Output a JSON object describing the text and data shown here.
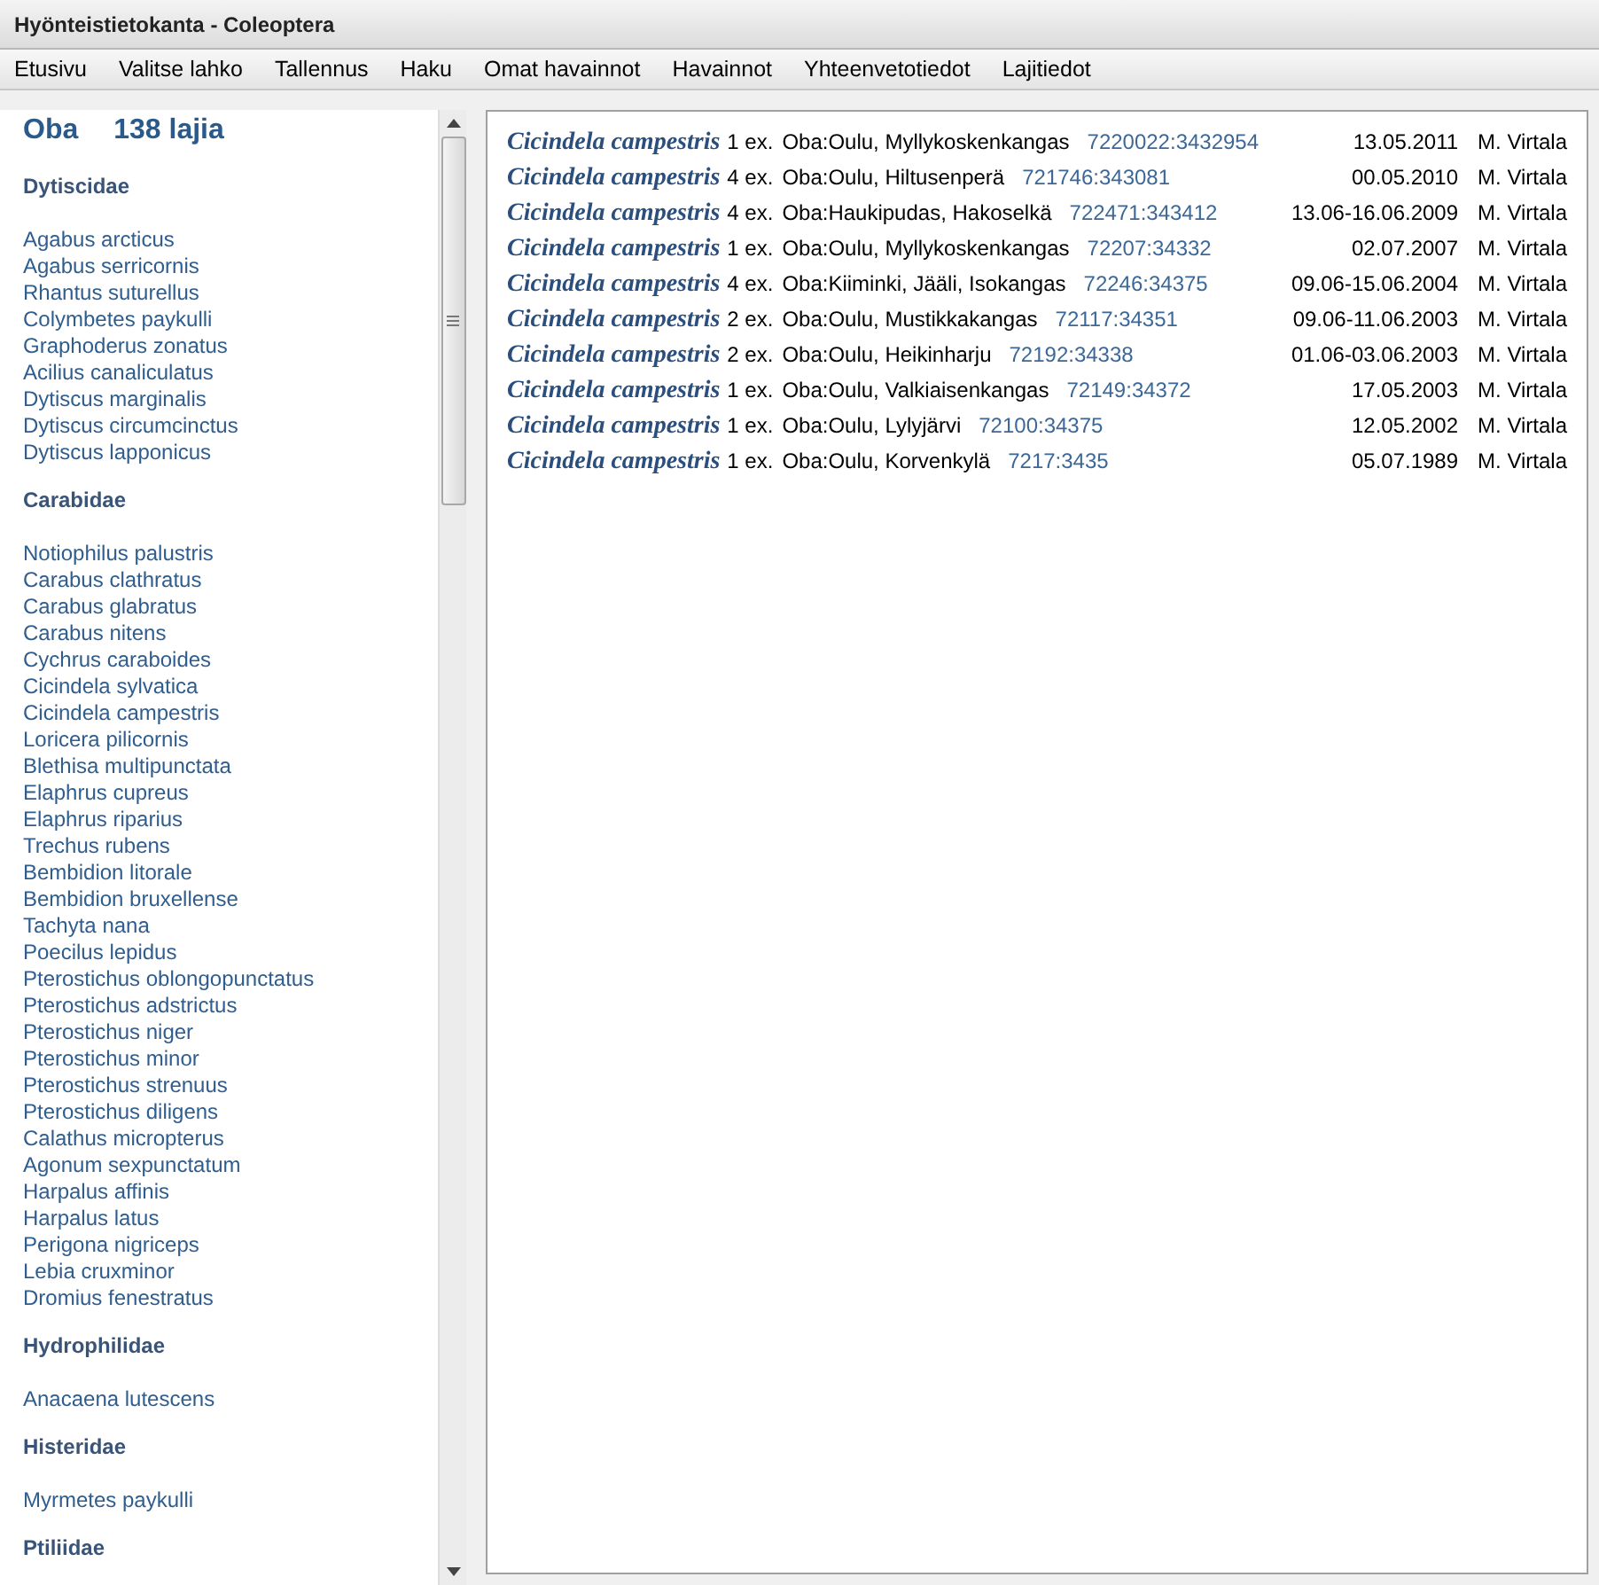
{
  "window": {
    "title": "Hyönteistietokanta - Coleoptera"
  },
  "menu": [
    "Etusivu",
    "Valitse lahko",
    "Tallennus",
    "Haku",
    "Omat havainnot",
    "Havainnot",
    "Yhteenvetotiedot",
    "Lajitiedot"
  ],
  "sidebar": {
    "region": "Oba",
    "count": "138 lajia",
    "families": [
      {
        "name": "Dytiscidae",
        "species": [
          "Agabus arcticus",
          "Agabus serricornis",
          "Rhantus suturellus",
          "Colymbetes paykulli",
          "Graphoderus zonatus",
          "Acilius canaliculatus",
          "Dytiscus marginalis",
          "Dytiscus circumcinctus",
          "Dytiscus lapponicus"
        ]
      },
      {
        "name": "Carabidae",
        "species": [
          "Notiophilus palustris",
          "Carabus clathratus",
          "Carabus glabratus",
          "Carabus nitens",
          "Cychrus caraboides",
          "Cicindela sylvatica",
          "Cicindela campestris",
          "Loricera pilicornis",
          "Blethisa multipunctata",
          "Elaphrus cupreus",
          "Elaphrus riparius",
          "Trechus rubens",
          "Bembidion litorale",
          "Bembidion bruxellense",
          "Tachyta nana",
          "Poecilus lepidus",
          "Pterostichus oblongopunctatus",
          "Pterostichus adstrictus",
          "Pterostichus niger",
          "Pterostichus minor",
          "Pterostichus strenuus",
          "Pterostichus diligens",
          "Calathus micropterus",
          "Agonum sexpunctatum",
          "Harpalus affinis",
          "Harpalus latus",
          "Perigona nigriceps",
          "Lebia cruxminor",
          "Dromius fenestratus"
        ]
      },
      {
        "name": "Hydrophilidae",
        "species": [
          "Anacaena lutescens"
        ]
      },
      {
        "name": "Histeridae",
        "species": [
          "Myrmetes paykulli"
        ]
      },
      {
        "name": "Ptiliidae"
      }
    ]
  },
  "observations": [
    {
      "species": "Cicindela campestris",
      "count": "1 ex.",
      "place": "Oba:Oulu, Myllykoskenkangas",
      "coords": "7220022:3432954",
      "date": "13.05.2011",
      "observer": "M. Virtala"
    },
    {
      "species": "Cicindela campestris",
      "count": "4 ex.",
      "place": "Oba:Oulu, Hiltusenperä",
      "coords": "721746:343081",
      "date": "00.05.2010",
      "observer": "M. Virtala"
    },
    {
      "species": "Cicindela campestris",
      "count": "4 ex.",
      "place": "Oba:Haukipudas, Hakoselkä",
      "coords": "722471:343412",
      "date": "13.06-16.06.2009",
      "observer": "M. Virtala"
    },
    {
      "species": "Cicindela campestris",
      "count": "1 ex.",
      "place": "Oba:Oulu, Myllykoskenkangas",
      "coords": "72207:34332",
      "date": "02.07.2007",
      "observer": "M. Virtala"
    },
    {
      "species": "Cicindela campestris",
      "count": "4 ex.",
      "place": "Oba:Kiiminki, Jääli, Isokangas",
      "coords": "72246:34375",
      "date": "09.06-15.06.2004",
      "observer": "M. Virtala"
    },
    {
      "species": "Cicindela campestris",
      "count": "2 ex.",
      "place": "Oba:Oulu, Mustikkakangas",
      "coords": "72117:34351",
      "date": "09.06-11.06.2003",
      "observer": "M. Virtala"
    },
    {
      "species": "Cicindela campestris",
      "count": "2 ex.",
      "place": "Oba:Oulu, Heikinharju",
      "coords": "72192:34338",
      "date": "01.06-03.06.2003",
      "observer": "M. Virtala"
    },
    {
      "species": "Cicindela campestris",
      "count": "1 ex.",
      "place": "Oba:Oulu, Valkiaisenkangas",
      "coords": "72149:34372",
      "date": "17.05.2003",
      "observer": "M. Virtala"
    },
    {
      "species": "Cicindela campestris",
      "count": "1 ex.",
      "place": "Oba:Oulu, Lylyjärvi",
      "coords": "72100:34375",
      "date": "12.05.2002",
      "observer": "M. Virtala"
    },
    {
      "species": "Cicindela campestris",
      "count": "1 ex.",
      "place": "Oba:Oulu, Korvenkylä",
      "coords": "7217:3435",
      "date": "05.07.1989",
      "observer": "M. Virtala"
    }
  ]
}
